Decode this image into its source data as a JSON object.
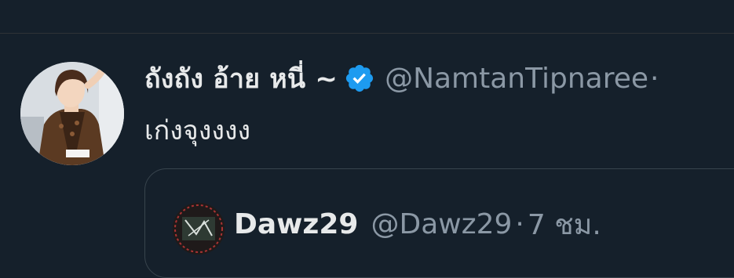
{
  "colors": {
    "background": "#15202b",
    "primary_text": "#e7e9ea",
    "secondary_text": "#8b98a5",
    "verified_badge": "#1d9bf0",
    "border": "#38444d"
  },
  "tweet": {
    "display_name": "ถังถัง อ้าย หนี่ ~",
    "verified_icon": "verified-badge-icon",
    "handle": "@NamtanTipnaree",
    "separator": "·",
    "text": "เก่งจุงงงง"
  },
  "quoted_tweet": {
    "display_name": "Dawz29",
    "handle": "@Dawz29",
    "separator": "·",
    "time": "7 ชม."
  }
}
